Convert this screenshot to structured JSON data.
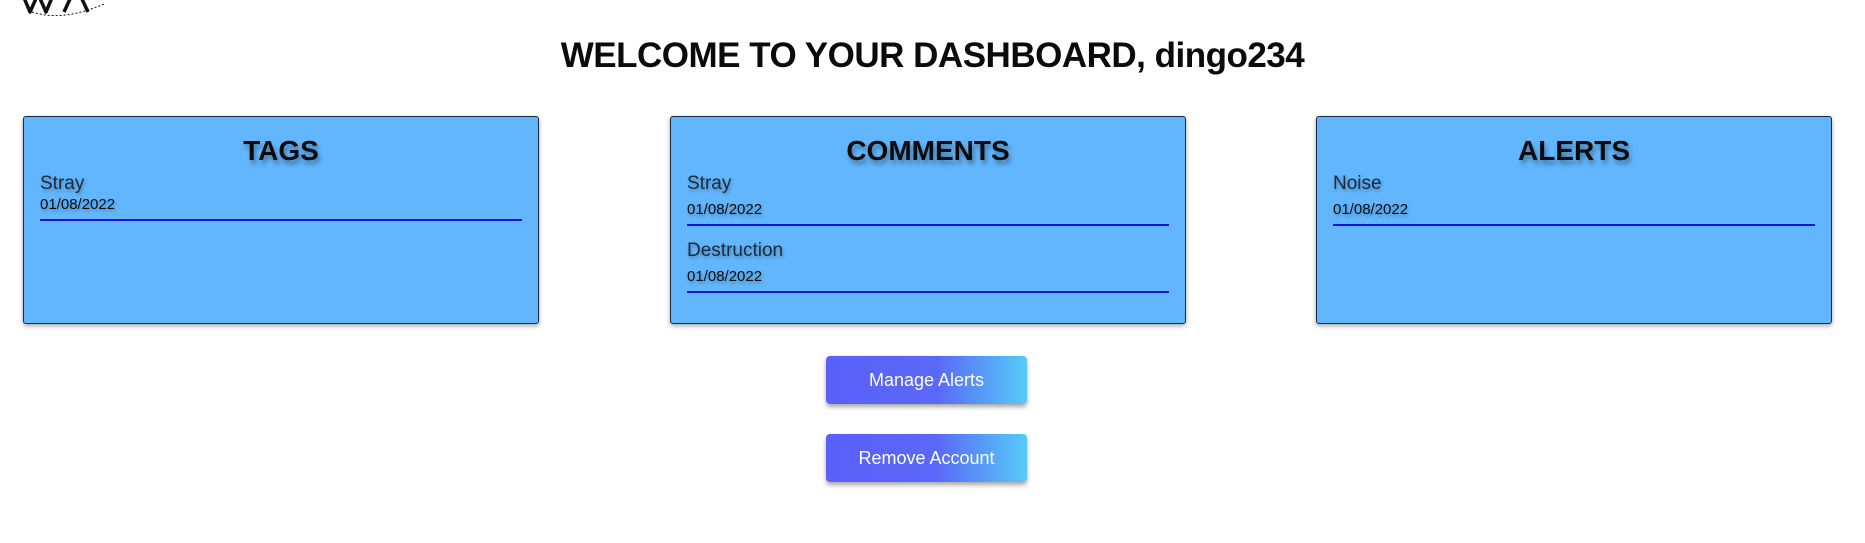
{
  "header": {
    "title": "WELCOME TO YOUR DASHBOARD, dingo234"
  },
  "cards": {
    "tags": {
      "title": "TAGS",
      "entries": [
        {
          "name": "Stray",
          "date": "01/08/2022"
        }
      ]
    },
    "comments": {
      "title": "COMMENTS",
      "entries": [
        {
          "name": "Stray",
          "date": "01/08/2022"
        },
        {
          "name": "Destruction",
          "date": "01/08/2022"
        }
      ]
    },
    "alerts": {
      "title": "ALERTS",
      "entries": [
        {
          "name": "Noise",
          "date": "01/08/2022"
        }
      ]
    }
  },
  "actions": {
    "manage_alerts_label": "Manage Alerts",
    "remove_account_label": "Remove Account"
  },
  "colors": {
    "card_background": "#62b6fd",
    "entry_divider": "#1414d8",
    "button_gradient_start": "#5a60f9",
    "button_gradient_end": "#55cbf7"
  },
  "icons": {
    "logo": "logo-icon"
  }
}
